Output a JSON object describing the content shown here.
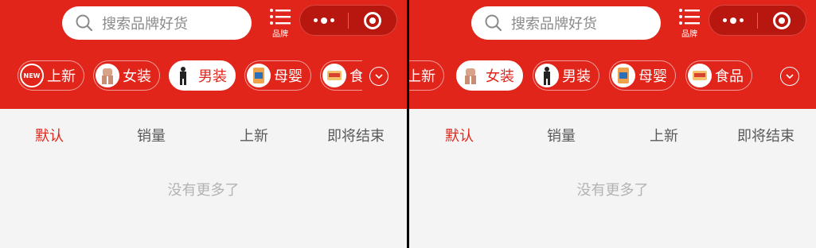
{
  "search": {
    "placeholder": "搜索品牌好货"
  },
  "brand_button": {
    "label": "品牌",
    "icon": "list-icon"
  },
  "capsule": {
    "menu_icon": "more-dots-icon",
    "close_icon": "target-icon"
  },
  "categories": [
    {
      "label": "上新",
      "badge": "NEW",
      "icon": "new-badge-icon"
    },
    {
      "label": "女装",
      "icon": "women-clothing-icon"
    },
    {
      "label": "男装",
      "icon": "men-clothing-icon"
    },
    {
      "label": "母婴",
      "icon": "baby-product-icon"
    },
    {
      "label": "食品",
      "icon": "food-icon"
    }
  ],
  "sort_tabs": [
    "默认",
    "销量",
    "上新",
    "即将结束"
  ],
  "empty_text": "没有更多了",
  "colors": {
    "brand_red": "#e1251b",
    "active_text": "#e1251b",
    "muted": "#b3b3b3"
  },
  "panels": [
    {
      "active_category": "男装",
      "active_tab": "默认"
    },
    {
      "active_category": "女装",
      "active_tab": "默认"
    }
  ]
}
